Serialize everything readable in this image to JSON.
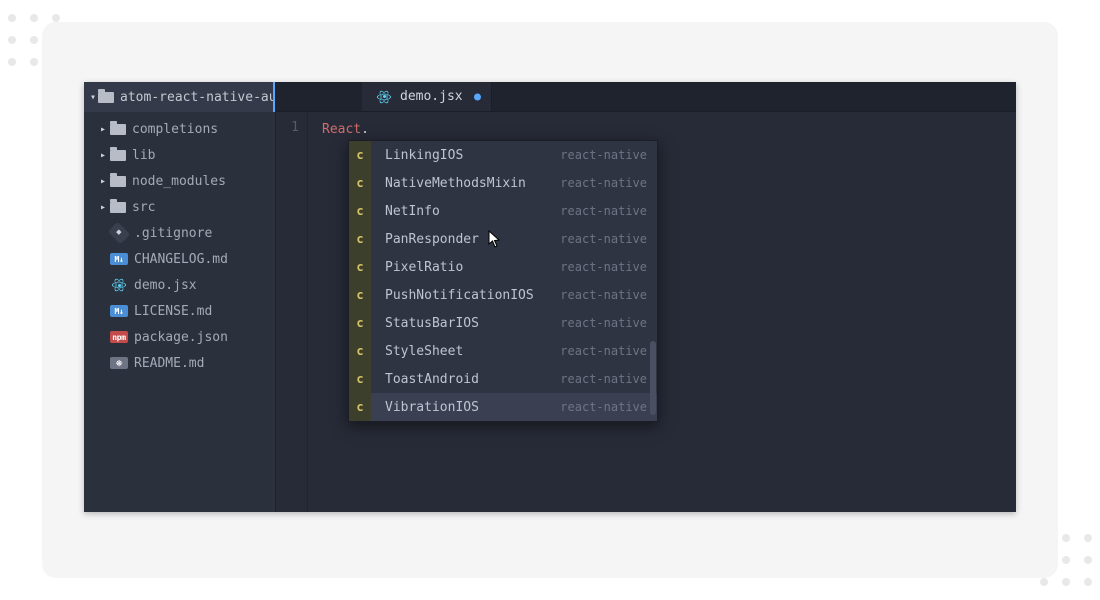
{
  "project": {
    "name": "atom-react-native-auto"
  },
  "tree": {
    "folders": [
      {
        "label": "completions"
      },
      {
        "label": "lib"
      },
      {
        "label": "node_modules"
      },
      {
        "label": "src"
      }
    ],
    "files": [
      {
        "icon": "git",
        "label": ".gitignore"
      },
      {
        "icon": "md",
        "label": "CHANGELOG.md"
      },
      {
        "icon": "react",
        "label": "demo.jsx"
      },
      {
        "icon": "md",
        "label": "LICENSE.md"
      },
      {
        "icon": "npm",
        "label": "package.json"
      },
      {
        "icon": "book",
        "label": "README.md"
      }
    ]
  },
  "tab": {
    "label": "demo.jsx",
    "dirty": true
  },
  "gutter": {
    "line1": "1"
  },
  "code": {
    "token_react": "React",
    "token_dot": "."
  },
  "autocomplete": {
    "kind_glyph": "c",
    "source": "react-native",
    "items": [
      {
        "label": "LinkingIOS"
      },
      {
        "label": "NativeMethodsMixin"
      },
      {
        "label": "NetInfo"
      },
      {
        "label": "PanResponder"
      },
      {
        "label": "PixelRatio"
      },
      {
        "label": "PushNotificationIOS"
      },
      {
        "label": "StatusBarIOS"
      },
      {
        "label": "StyleSheet"
      },
      {
        "label": "ToastAndroid"
      },
      {
        "label": "VibrationIOS"
      }
    ],
    "selected_index": 9
  },
  "badges": {
    "md": "M↓",
    "npm": "npm",
    "book": "⁜"
  }
}
